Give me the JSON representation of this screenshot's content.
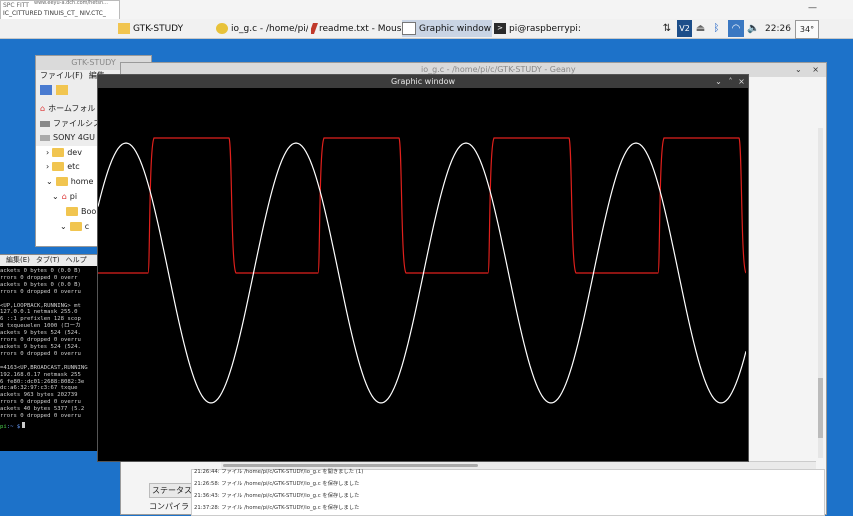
{
  "top_strip": {
    "browser_url": "www.eeyu-a.dch.com/hetsn...",
    "tab_label": "SPC FITT",
    "tab2_label": "IC_CITTURED TINUIS_CT_ NIV.CTC_"
  },
  "taskbar": {
    "tasks": [
      {
        "label": "GTK-STUDY"
      },
      {
        "label": "io_g.c - /home/pi/c/G..."
      },
      {
        "label": "readme.txt - Mousepad"
      },
      {
        "label": "Graphic window"
      },
      {
        "label": "pi@raspberrypi: ~"
      }
    ],
    "clock": "22:26",
    "cpu": "34°"
  },
  "file_manager": {
    "title": "GTK-STUDY",
    "menu": [
      "ファイル(F)",
      "編集"
    ],
    "places": [
      "ホームフォル",
      "ファイルシス",
      "SONY 4GU"
    ],
    "tree": [
      "dev",
      "etc",
      "home",
      "pi",
      "Book",
      "c"
    ]
  },
  "geany": {
    "title": "io_g.c - /home/pi/c/GTK-STUDY - Geany",
    "status_tab": "ステータス",
    "compiler_tab": "コンパイラ",
    "messages": [
      "21:26:44: ファイル /home/pi/c/GTK-STUDY/io_g.c を開きました (1)",
      "21:26:58: ファイル /home/pi/c/GTK-STUDY/io_g.c を保存しました",
      "21:36:43: ファイル /home/pi/c/GTK-STUDY/io_g.c を保存しました",
      "21:37:28: ファイル /home/pi/c/GTK-STUDY/io_g.c を保存しました"
    ]
  },
  "terminal": {
    "menu": [
      "編集(E)",
      "タブ(T)",
      "ヘルプ"
    ],
    "lines": [
      "ackets 0  bytes 0 (0.0 B)",
      "rrors 0  dropped 0  overr",
      "ackets 0  bytes 0 (0.0 B)",
      "rrors 0  dropped 0  overru",
      "",
      "<UP,LOOPBACK,RUNNING>  mt",
      " 127.0.0.1  netmask 255.0",
      "6 ::1  prefixlen 128  scop",
      "8 txqueuelen 1000  (ローカ",
      "ackets 9  bytes 524 (524.",
      "rrors 0  dropped 0  overru",
      "ackets 9  bytes 524 (524.",
      "rrors 0  dropped 0  overru",
      "",
      "=4163<UP,BROADCAST,RUNNING",
      " 192.168.0.17  netmask 255",
      "6 fe80::dc01:2688:8082:3e",
      " dc:a6:32:97:c3:67  txque",
      "ackets 963  bytes 202739",
      "rrors 0  dropped 0  overru",
      "ackets 40  bytes 5377 (5.2",
      "rrors 0  dropped 0  overru"
    ],
    "prompt_user": "pi",
    "prompt_rest": ":~ $"
  },
  "graphic_window": {
    "title": "Graphic window",
    "minimize": "⌄",
    "maximize": "˄",
    "close": "×",
    "sine_color": "#ffffff",
    "square_color": "#e0201c",
    "square_duty": 0.5,
    "cycles_visible": 3.7
  }
}
